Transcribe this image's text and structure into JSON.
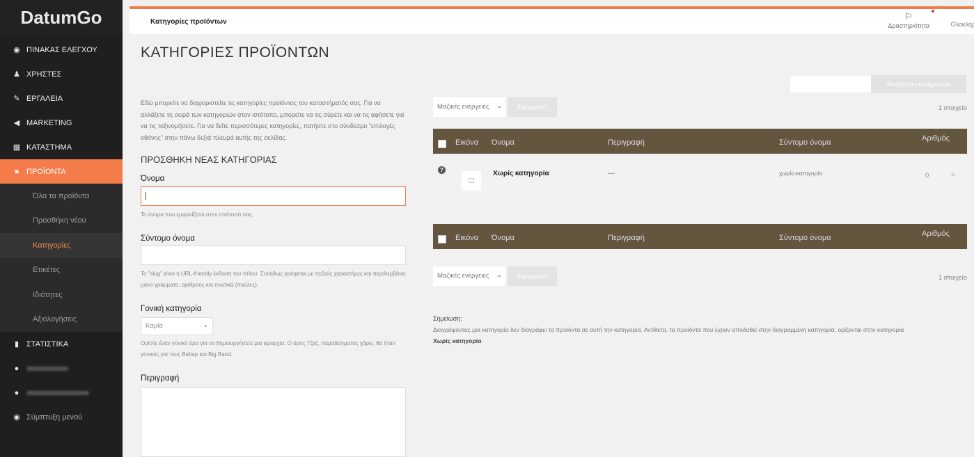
{
  "app": {
    "logo": "DatumGo"
  },
  "sidebar": {
    "items": [
      {
        "label": "ΠΙΝΑΚΑΣ ΕΛΕΓΧΟΥ",
        "icon": "dashboard-icon",
        "glyph": "◉"
      },
      {
        "label": "ΧΡΗΣΤΕΣ",
        "icon": "user-icon",
        "glyph": "♟"
      },
      {
        "label": "ΕΡΓΑΛΕΙΑ",
        "icon": "wrench-icon",
        "glyph": "✎"
      },
      {
        "label": "MARKETING",
        "icon": "megaphone-icon",
        "glyph": "◀"
      },
      {
        "label": "ΚΑΤΑΣΤΗΜΑ",
        "icon": "store-icon",
        "glyph": "▦"
      },
      {
        "label": "ΠΡΟΪΟΝΤΑ",
        "icon": "box-icon",
        "glyph": "■"
      }
    ],
    "sub_items": [
      {
        "label": "Όλα τα προϊόντα"
      },
      {
        "label": "Προσθήκη νέου"
      },
      {
        "label": "Κατηγορίες"
      },
      {
        "label": "Ετικέτες"
      },
      {
        "label": "Ιδιότητες"
      },
      {
        "label": "Αξιολογήσεις"
      }
    ],
    "stats": {
      "label": "ΣΤΑΤΙΣΤΙΚΑ",
      "icon": "bar-chart-icon",
      "glyph": "▮"
    },
    "collapse": {
      "label": "Σύμπτυξη μενού",
      "icon": "collapse-icon",
      "glyph": "◉"
    }
  },
  "topbar": {
    "breadcrumb": "Κατηγορίες προϊόντων",
    "activity_label": "Δραστηριότητα",
    "complete_label": "Ολοκλήρ",
    "accent_color": "#f47b4a"
  },
  "page": {
    "title": "ΚΑΤΗΓΟΡΙΕΣ ΠΡΟΪΟΝΤΩΝ"
  },
  "form": {
    "intro": "Εδώ μπορείτε να διαχειριστείτε τις κατηγορίες προϊόντος του καταστήματός σας. Για να αλλάξετε τη σειρά των κατηγοριών στον ιστότοπο, μπορείτε να τις σύρετε και να τις αφήσετε για να τις ταξινομήσετε. Για να δείτε περισσότερες κατηγορίες, πατήστε στο σύνδεσμο \"επιλογές οθόνης\" στην πάνω δεξιά πλευρά αυτής της σελίδας.",
    "heading": "ΠΡΟΣΘΗΚΗ ΝΕΑΣ ΚΑΤΗΓΟΡΙΑΣ",
    "name_label": "Όνομα",
    "name_value": "",
    "name_help": "Το όνομα που εμφανίζεται στον ιστότοπό σας.",
    "slug_label": "Σύντομο όνομα",
    "slug_value": "",
    "slug_help": "Το \"slug\" είναι η URL-friendly έκδοση του τίτλου. Συνήθως γράφεται με πεζούς χαρακτήρες και περιλαμβάνει μόνο γράμματα, αριθμούς και ενωτικά (παύλες).",
    "parent_label": "Γονική κατηγορία",
    "parent_value": "Καμία",
    "parent_help": "Ορίστε έναν γονικό όρο για να δημιουργήσετε μια ιεραρχία. Ο όρος Τζαζ, παραδείγματος χάριν, θα ήταν γονικός για τους Bebop και Big Band.",
    "desc_label": "Περιγραφή"
  },
  "list": {
    "search_button": "Αναζήτηση κατηγοριών",
    "bulk_label": "Μαζικές ενέργειες",
    "apply_label": "Εφαρμογή",
    "count": "1 στοιχείο",
    "columns": {
      "image": "Εικόνα",
      "name": "Όνομα",
      "description": "Περιγραφή",
      "slug": "Σύντομο όνομα",
      "count": "Αριθμός"
    },
    "rows": [
      {
        "name": "Χωρίς κατηγορία",
        "description": "—",
        "slug": "χωρίς-κατηγορία",
        "count": "0"
      }
    ]
  },
  "note": {
    "title": "Σημείωση:",
    "text": "Διαγράφοντας μια κατηγορία δεν διαγράφει τα προϊόντα σε αυτή την κατηγορία. Αντίθετα, τα προϊόντα που έχουν αποδοθεί στην διαγραμμένη κατηγορία, ορίζονται στην κατηγορία",
    "category": "Χωρίς κατηγορία",
    "period": "."
  }
}
